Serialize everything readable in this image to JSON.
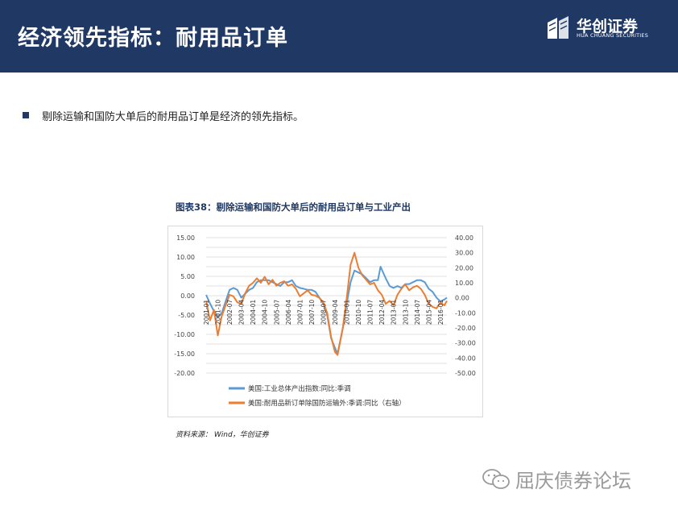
{
  "header": {
    "title": "经济领先指标：耐用品订单",
    "logo_cn": "华创证券",
    "logo_en": "HUA CHUANG SECURITIES"
  },
  "bullet": {
    "text": "剔除运输和国防大单后的耐用品订单是经济的领先指标。"
  },
  "chart": {
    "caption": "图表38：剔除运输和国防大单后的耐用品订单与工业产出",
    "source": "资料来源： Wind，华创证券"
  },
  "watermark": {
    "text": "屈庆债券论坛"
  },
  "colors": {
    "header_bg": "#1f3864",
    "series1": "#5b9bd5",
    "series2": "#ed7d31",
    "grid": "#d9d9d9"
  },
  "chart_data": {
    "type": "line",
    "x_tick_labels": [
      "2001-01",
      "2001-10",
      "2002-07",
      "2003-04",
      "2004-01",
      "2004-10",
      "2005-07",
      "2006-04",
      "2007-01",
      "2007-10",
      "2008-07",
      "2009-04",
      "2010-01",
      "2010-10",
      "2011-07",
      "2012-04",
      "2013-01",
      "2013-10",
      "2014-07",
      "2015-04",
      "2016-01"
    ],
    "x_start": "2001-01",
    "x_end": "2016-06",
    "y_left": {
      "min": -20,
      "max": 15,
      "step": 2.5,
      "tick_labels": [
        "15.00",
        "12.50",
        "10.00",
        "7.50",
        "5.00",
        "2.50",
        "0.00",
        "-2.50",
        "-5.00",
        "-7.50",
        "-10.00",
        "-12.50",
        "-15.00",
        "-17.50",
        "-20.00"
      ]
    },
    "y_right": {
      "min": -50,
      "max": 40,
      "step": 10,
      "tick_labels": [
        "40.00",
        "30.00",
        "20.00",
        "10.00",
        "0.00",
        "-10.00",
        "-20.00",
        "-30.00",
        "-40.00",
        "-50.00"
      ]
    },
    "series": [
      {
        "name": "美国:工业总体产出指数:同比:季调",
        "axis": "left",
        "points": [
          [
            "2001-01",
            0.2
          ],
          [
            "2001-04",
            -2.0
          ],
          [
            "2001-07",
            -4.0
          ],
          [
            "2001-10",
            -5.5
          ],
          [
            "2002-01",
            -4.5
          ],
          [
            "2002-04",
            -1.5
          ],
          [
            "2002-07",
            1.5
          ],
          [
            "2002-10",
            2.0
          ],
          [
            "2003-01",
            1.5
          ],
          [
            "2003-04",
            -0.5
          ],
          [
            "2003-07",
            0.5
          ],
          [
            "2003-10",
            1.5
          ],
          [
            "2004-01",
            2.0
          ],
          [
            "2004-04",
            3.5
          ],
          [
            "2004-07",
            4.0
          ],
          [
            "2004-10",
            4.0
          ],
          [
            "2005-01",
            4.0
          ],
          [
            "2005-04",
            3.5
          ],
          [
            "2005-07",
            3.0
          ],
          [
            "2005-10",
            2.5
          ],
          [
            "2006-01",
            3.5
          ],
          [
            "2006-04",
            3.5
          ],
          [
            "2006-07",
            4.0
          ],
          [
            "2006-10",
            2.5
          ],
          [
            "2007-01",
            2.0
          ],
          [
            "2007-04",
            1.8
          ],
          [
            "2007-07",
            1.5
          ],
          [
            "2007-10",
            1.5
          ],
          [
            "2008-01",
            1.0
          ],
          [
            "2008-04",
            -0.5
          ],
          [
            "2008-07",
            -2.0
          ],
          [
            "2008-10",
            -5.0
          ],
          [
            "2009-01",
            -11.0
          ],
          [
            "2009-04",
            -13.5
          ],
          [
            "2009-06",
            -15.0
          ],
          [
            "2009-10",
            -8.5
          ],
          [
            "2010-01",
            -2.0
          ],
          [
            "2010-04",
            3.5
          ],
          [
            "2010-07",
            6.5
          ],
          [
            "2010-10",
            6.0
          ],
          [
            "2011-01",
            5.5
          ],
          [
            "2011-04",
            4.5
          ],
          [
            "2011-07",
            3.5
          ],
          [
            "2011-10",
            4.0
          ],
          [
            "2012-01",
            4.0
          ],
          [
            "2012-03",
            7.5
          ],
          [
            "2012-07",
            4.5
          ],
          [
            "2012-10",
            2.5
          ],
          [
            "2013-01",
            2.0
          ],
          [
            "2013-04",
            2.5
          ],
          [
            "2013-07",
            2.0
          ],
          [
            "2013-10",
            3.0
          ],
          [
            "2014-01",
            3.0
          ],
          [
            "2014-04",
            3.5
          ],
          [
            "2014-07",
            4.0
          ],
          [
            "2014-10",
            4.0
          ],
          [
            "2015-01",
            3.5
          ],
          [
            "2015-04",
            1.8
          ],
          [
            "2015-07",
            1.0
          ],
          [
            "2015-10",
            -0.5
          ],
          [
            "2016-01",
            -1.5
          ],
          [
            "2016-04",
            -1.0
          ],
          [
            "2016-06",
            -0.5
          ]
        ]
      },
      {
        "name": "美国:耐用品新订单除国防运输外:季调:同比（右轴）",
        "axis": "right",
        "points": [
          [
            "2001-01",
            -2.0
          ],
          [
            "2001-04",
            -15.0
          ],
          [
            "2001-07",
            -8.0
          ],
          [
            "2001-10",
            -25.0
          ],
          [
            "2002-01",
            -12.0
          ],
          [
            "2002-04",
            -5.0
          ],
          [
            "2002-07",
            2.0
          ],
          [
            "2002-10",
            1.0
          ],
          [
            "2003-01",
            -3.0
          ],
          [
            "2003-04",
            -4.0
          ],
          [
            "2003-07",
            3.0
          ],
          [
            "2003-10",
            8.0
          ],
          [
            "2004-01",
            10.0
          ],
          [
            "2004-04",
            13.0
          ],
          [
            "2004-07",
            10.0
          ],
          [
            "2004-10",
            14.0
          ],
          [
            "2005-01",
            9.0
          ],
          [
            "2005-04",
            12.0
          ],
          [
            "2005-07",
            8.0
          ],
          [
            "2005-10",
            10.0
          ],
          [
            "2006-01",
            11.0
          ],
          [
            "2006-04",
            8.0
          ],
          [
            "2006-07",
            9.0
          ],
          [
            "2006-10",
            6.0
          ],
          [
            "2007-01",
            1.0
          ],
          [
            "2007-04",
            3.0
          ],
          [
            "2007-07",
            5.0
          ],
          [
            "2007-10",
            2.0
          ],
          [
            "2008-01",
            1.5
          ],
          [
            "2008-04",
            0.0
          ],
          [
            "2008-07",
            -3.0
          ],
          [
            "2008-10",
            -10.0
          ],
          [
            "2009-01",
            -26.0
          ],
          [
            "2009-04",
            -36.0
          ],
          [
            "2009-06",
            -38.0
          ],
          [
            "2009-10",
            -20.0
          ],
          [
            "2010-01",
            0.0
          ],
          [
            "2010-04",
            22.0
          ],
          [
            "2010-07",
            30.0
          ],
          [
            "2010-10",
            20.0
          ],
          [
            "2011-01",
            15.0
          ],
          [
            "2011-04",
            12.0
          ],
          [
            "2011-07",
            9.0
          ],
          [
            "2011-10",
            10.0
          ],
          [
            "2012-01",
            5.0
          ],
          [
            "2012-04",
            2.0
          ],
          [
            "2012-07",
            -4.0
          ],
          [
            "2012-10",
            -2.0
          ],
          [
            "2013-01",
            -5.0
          ],
          [
            "2013-04",
            2.0
          ],
          [
            "2013-07",
            6.0
          ],
          [
            "2013-10",
            9.0
          ],
          [
            "2014-01",
            5.0
          ],
          [
            "2014-04",
            7.0
          ],
          [
            "2014-07",
            8.0
          ],
          [
            "2014-10",
            6.0
          ],
          [
            "2015-01",
            2.0
          ],
          [
            "2015-04",
            -4.0
          ],
          [
            "2015-07",
            -6.0
          ],
          [
            "2015-10",
            -7.0
          ],
          [
            "2016-01",
            -3.0
          ],
          [
            "2016-04",
            -5.0
          ],
          [
            "2016-06",
            -2.0
          ]
        ]
      }
    ]
  }
}
